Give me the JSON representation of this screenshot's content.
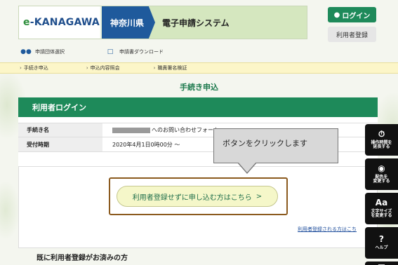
{
  "header": {
    "logo_prefix": "e",
    "logo_text": "-KANAGAWA",
    "prefecture": "神奈川県",
    "system_name": "電子申請システム",
    "login_label": "ログイン",
    "register_label": "利用者登録"
  },
  "subnav": [
    {
      "label": "申請団体選択",
      "icon": "group-icon"
    },
    {
      "label": "申請書ダウンロード",
      "icon": "download-icon"
    }
  ],
  "steps": [
    {
      "label": "手続き申込"
    },
    {
      "label": "申込内容照会"
    },
    {
      "label": "職責署名検証"
    }
  ],
  "page_title": "手続き申込",
  "panel": {
    "heading": "利用者ログイン",
    "rows": [
      {
        "label": "手続き名",
        "value": "へのお問い合わせフォーム"
      },
      {
        "label": "受付時期",
        "value": "2020年4月1日0時00分 〜"
      }
    ]
  },
  "no_register_button": "利用者登録せずに申し込む方はこちら",
  "no_register_arrow": ">",
  "registered_link": "利用者登録される方はこち",
  "already_heading": "既に利用者登録がお済みの方",
  "callout": "ボタンをクリックします",
  "tools": [
    {
      "label": "操作時間を\n延長する",
      "icon": "timer-icon"
    },
    {
      "label": "配色を\n変更する",
      "icon": "palette-icon"
    },
    {
      "label": "文字サイズ\nを変更する",
      "icon": "text-size-icon"
    },
    {
      "label": "ヘルプ",
      "icon": "help-icon"
    }
  ],
  "colors": {
    "accent": "#1e8a5a",
    "brand": "#1f5a9c",
    "highlight": "#8b5a1e"
  }
}
